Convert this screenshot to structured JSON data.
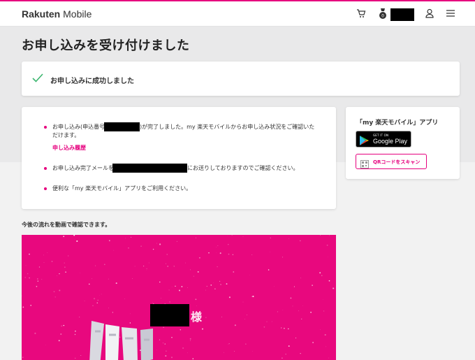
{
  "header": {
    "logo_brand": "Rakuten",
    "logo_product": " Mobile",
    "icons": [
      "cart-icon",
      "points-badge-icon",
      "user-icon",
      "menu-icon"
    ]
  },
  "page": {
    "title": "お申し込みを受け付けました"
  },
  "success": {
    "message": "お申し込みに成功しました"
  },
  "info": {
    "item1_prefix": "お申し込み(申込番号",
    "item1_suffix": ")が完了しました。my 楽天モバイルからお申し込み状況をご確認いた",
    "item1_line2": "だけます。",
    "item1_link": "申し込み履歴",
    "item2_prefix": "お申し込み完了メールを",
    "item2_suffix": "にお送りしておりますのでご確認ください。",
    "item3": "便利な「my 楽天モバイル」アプリをご利用ください。"
  },
  "app": {
    "title": "「my 楽天モバイル」アプリ",
    "gplay_small": "GET IT ON",
    "gplay_big": "Google Play",
    "qr_label": "QRコードをスキャン"
  },
  "video": {
    "heading": "今後の流れを動画で確認できます。",
    "suffix": "様"
  },
  "colors": {
    "accent": "#e6007e",
    "success_check": "#3cb66f"
  }
}
